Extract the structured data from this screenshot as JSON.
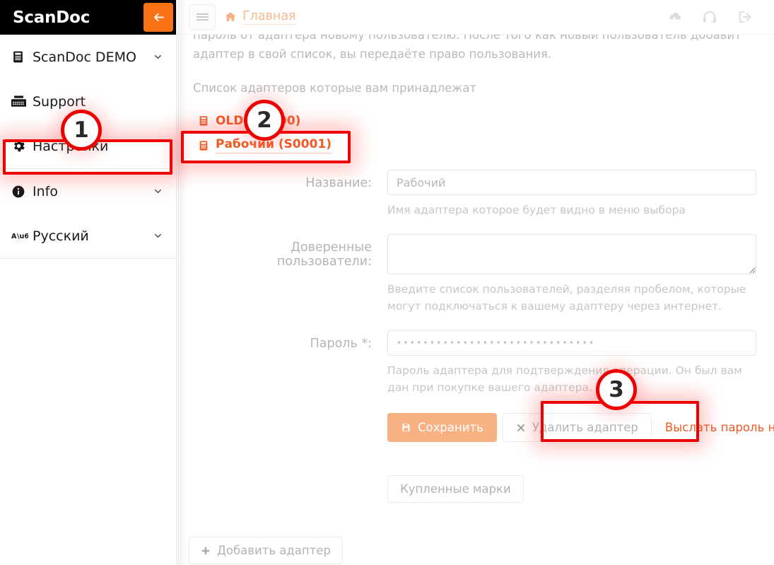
{
  "sidebar": {
    "brand": "ScanDoc",
    "collapse_icon": "arrow-left-icon",
    "items": [
      {
        "label": "ScanDoc DEMO",
        "icon": "fax-icon",
        "caret": "⌄"
      },
      {
        "label": "Support",
        "icon": "fax-machine-icon",
        "caret": ""
      },
      {
        "label": "Настройки",
        "icon": "gear-icon",
        "caret": ""
      },
      {
        "label": "Info",
        "icon": "info-circle-icon",
        "caret": "⌄"
      },
      {
        "label": "Русский",
        "icon": "language-icon",
        "caret": "⌄"
      }
    ]
  },
  "topbar": {
    "menu_toggle": "hamburger-icon",
    "breadcrumb": "Главная",
    "icons": [
      "cloud-download-icon",
      "headset-icon",
      "sign-out-icon"
    ]
  },
  "main": {
    "paragraph_1": "пароль от адаптера новому пользователю. После того как новый пользователь добавит адаптер в свой список, вы передаёте право пользования.",
    "paragraph_2": "Список адаптеров которые вам принадлежат",
    "adapters": [
      {
        "name": "OLD (S0000)",
        "icon": "fax-icon",
        "selected": false
      },
      {
        "name": "Рабочий (S0001)",
        "icon": "fax-icon",
        "selected": true
      }
    ],
    "form": {
      "name_label": "Название:",
      "name_value": "Рабочий",
      "name_help": "Имя адаптера которое будет видно в меню выбора",
      "trusted_label": "Доверенные пользователи:",
      "trusted_value": "",
      "trusted_help": "Введите список пользователей, разделяя пробелом, которые могут подключаться к вашему адаптеру через интернет.",
      "password_label": "Пароль *:",
      "password_value": "••••••••••••••••••••••••••••••",
      "password_help": "Пароль адаптера для подтверждения операции. Он был вам дан при покупке вашего адаптера."
    },
    "buttons": {
      "save": "Сохранить",
      "save_icon": "floppy-save-icon",
      "delete": "Удалить адаптер",
      "delete_icon": "times-icon",
      "send_password": "Выслать пароль на E-Mail",
      "marks": "Купленные марки",
      "add_adapter": "Добавить адаптер",
      "add_icon": "plus-icon"
    }
  },
  "annotations": {
    "accent_color": "#ef0000",
    "steps": [
      {
        "number": "1",
        "target": "sidebar-item-Настройки"
      },
      {
        "number": "2",
        "target": "adapter-Рабочий"
      },
      {
        "number": "3",
        "target": "send-password-button"
      }
    ]
  },
  "theme": {
    "brand_bg": "#000000",
    "accent_orange": "#f15a24",
    "collapse_orange": "#f97316",
    "muted_text": "#b9b9b9"
  }
}
